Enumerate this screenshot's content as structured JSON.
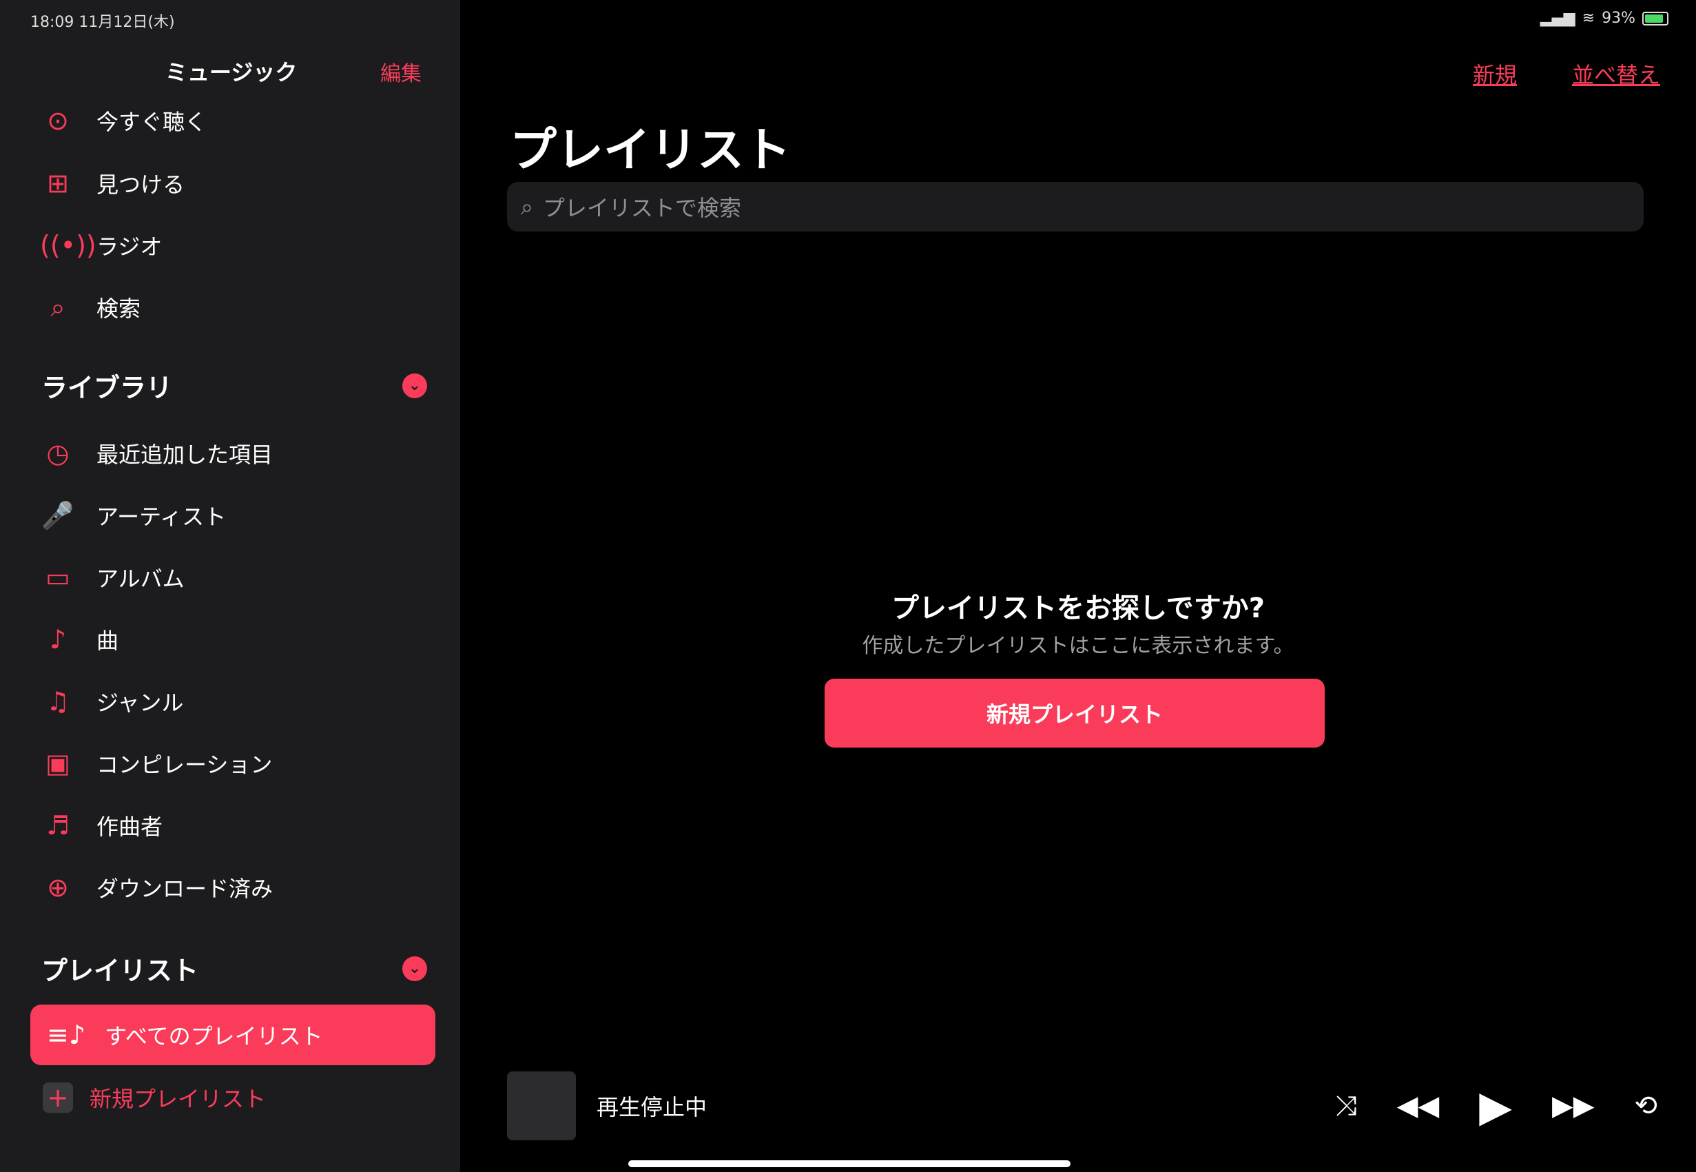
{
  "status": {
    "time": "18:09",
    "date": "11月12日(木)",
    "battery": "93%"
  },
  "sidebar": {
    "title": "ミュージック",
    "edit": "編集",
    "top_items": [
      {
        "label": "今すぐ聴く",
        "icon": "play-circle-icon"
      },
      {
        "label": "見つける",
        "icon": "grid-icon"
      },
      {
        "label": "ラジオ",
        "icon": "radio-icon"
      },
      {
        "label": "検索",
        "icon": "search-icon"
      }
    ],
    "library": {
      "heading": "ライブラリ",
      "items": [
        {
          "label": "最近追加した項目",
          "icon": "clock-icon"
        },
        {
          "label": "アーティスト",
          "icon": "microphone-icon"
        },
        {
          "label": "アルバム",
          "icon": "album-icon"
        },
        {
          "label": "曲",
          "icon": "music-note-icon"
        },
        {
          "label": "ジャンル",
          "icon": "genre-icon"
        },
        {
          "label": "コンピレーション",
          "icon": "compilation-icon"
        },
        {
          "label": "作曲者",
          "icon": "composer-icon"
        },
        {
          "label": "ダウンロード済み",
          "icon": "download-icon"
        }
      ]
    },
    "playlists": {
      "heading": "プレイリスト",
      "all": "すべてのプレイリスト",
      "new": "新規プレイリスト"
    }
  },
  "main": {
    "new_link": "新規",
    "sort_link": "並べ替え",
    "title": "プレイリスト",
    "search_placeholder": "プレイリストで検索",
    "empty_title": "プレイリストをお探しですか?",
    "empty_subtitle": "作成したプレイリストはここに表示されます。",
    "new_button": "新規プレイリスト"
  },
  "player": {
    "status": "再生停止中"
  },
  "colors": {
    "accent": "#fa3c5a",
    "sidebar_bg": "#1c1c1e",
    "main_bg": "#000000"
  }
}
